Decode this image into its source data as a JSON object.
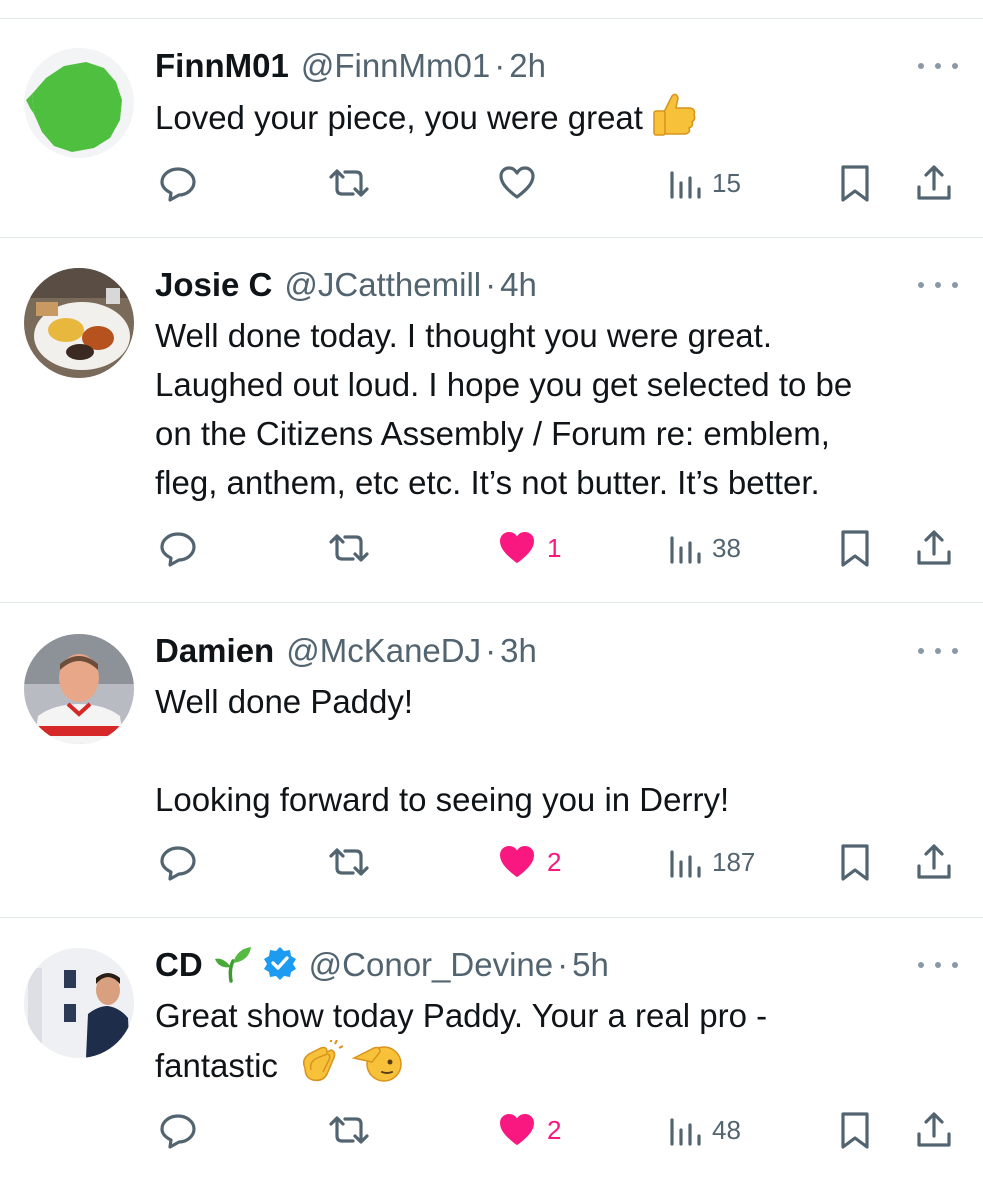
{
  "tweets": [
    {
      "name": "FinnM01",
      "handle": "@FinnMm01",
      "sep": "·",
      "time": "2h",
      "lines": [
        "Loved your piece, you were great"
      ],
      "emoji": [
        "thumbs-up"
      ],
      "reply_count": "",
      "retweet_count": "",
      "like_count": "",
      "liked": false,
      "views": "15",
      "avatar": "ireland-map"
    },
    {
      "name": "Josie C",
      "handle": "@JCatthemill",
      "sep": "·",
      "time": "4h",
      "lines": [
        "Well done today. I thought you were great.",
        "Laughed out loud. I hope you get selected to be",
        "on the Citizens Assembly / Forum re: emblem,",
        "fleg, anthem, etc etc. It’s not butter. It’s better."
      ],
      "like_count": "1",
      "liked": true,
      "views": "38",
      "avatar": "breakfast-plate"
    },
    {
      "name": "Damien",
      "handle": "@McKaneDJ",
      "sep": "·",
      "time": "3h",
      "lines": [
        "Well done Paddy!",
        "",
        "Looking forward to seeing you in Derry!"
      ],
      "like_count": "2",
      "liked": true,
      "views": "187",
      "avatar": "man-in-jersey"
    },
    {
      "name": "CD",
      "handle": "@Conor_Devine",
      "sep": "·",
      "time": "5h",
      "lines": [
        "Great show today Paddy. Your a real pro -",
        "fantastic"
      ],
      "emoji": [
        "clapping-hands",
        "saluting-face"
      ],
      "name_emoji": "seedling",
      "verified": true,
      "like_count": "2",
      "liked": true,
      "views": "48",
      "avatar": "man-in-suit"
    }
  ],
  "colors": {
    "text": "#0f1419",
    "secondary": "#536471",
    "like": "#f91880",
    "verified": "#1d9bf0",
    "divider": "#e1e6ea"
  }
}
